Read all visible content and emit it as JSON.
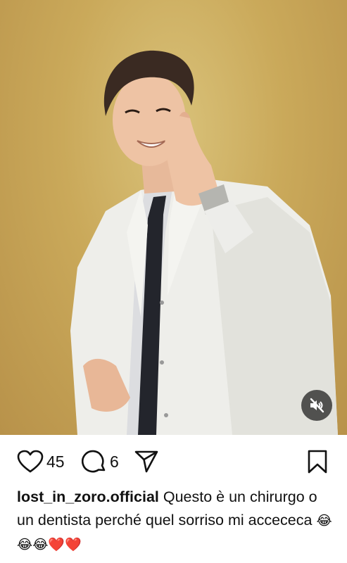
{
  "post": {
    "username": "lost_in_zoro.official",
    "caption_text": "Questo è un chirurgo o un dentista perché quel sorriso mi accececa",
    "caption_emojis": "😂😂😂❤️❤️"
  },
  "actions": {
    "likes_count": "45",
    "comments_count": "6"
  },
  "media": {
    "mute_state": "muted",
    "background_color": "#caa95a"
  },
  "icons": {
    "like": "heart-icon",
    "comment": "comment-bubble-icon",
    "share": "paper-plane-icon",
    "save": "bookmark-icon",
    "mute": "speaker-muted-icon"
  }
}
